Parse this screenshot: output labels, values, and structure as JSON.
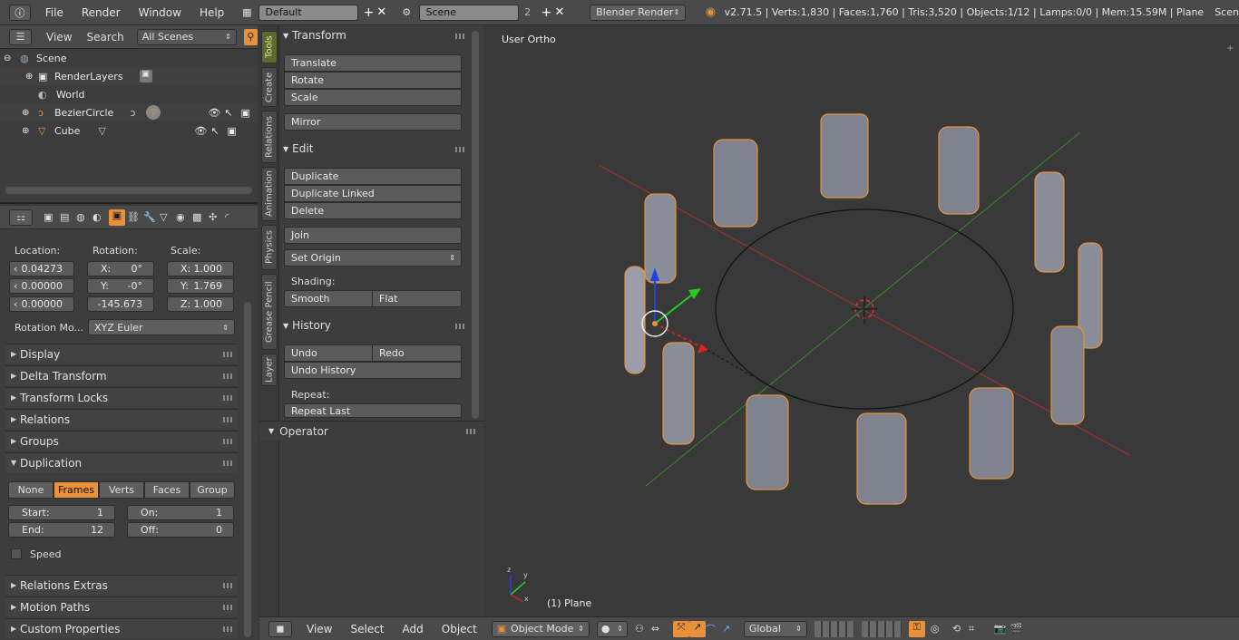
{
  "topbar": {
    "menus": [
      "File",
      "Render",
      "Window",
      "Help"
    ],
    "screen_layout": "Default",
    "scene": "Scene",
    "scene_users": "2",
    "render_engine": "Blender Render",
    "stats": "v2.71.5 | Verts:1,830 | Faces:1,760 | Tris:3,520 | Objects:1/12 | Lamps:0/0 | Mem:15.59M | Plane",
    "right_cut": "Scen"
  },
  "outliner": {
    "header": {
      "view": "View",
      "search": "Search",
      "scene_filter": "All Scenes"
    },
    "items": [
      {
        "label": "Scene"
      },
      {
        "label": "RenderLayers"
      },
      {
        "label": "World"
      },
      {
        "label": "BezierCircle"
      },
      {
        "label": "Cube"
      }
    ]
  },
  "properties": {
    "location_label": "Location:",
    "rotation_label": "Rotation:",
    "scale_label": "Scale:",
    "location": [
      "0.04273",
      "0.00000",
      "0.00000"
    ],
    "rotation": [
      {
        "axis": "X:",
        "val": "0°"
      },
      {
        "axis": "Y:",
        "val": "-0°"
      },
      {
        "axis": "",
        "val": "-145.673"
      }
    ],
    "scale": [
      {
        "axis": "X:",
        "val": "1.000"
      },
      {
        "axis": "Y:",
        "val": "1.769"
      },
      {
        "axis": "Z:",
        "val": "1.000"
      }
    ],
    "rotation_mode_label": "Rotation Mo...",
    "rotation_mode": "XYZ Euler",
    "panels_top": [
      "Display",
      "Delta Transform",
      "Transform Locks",
      "Relations",
      "Groups"
    ],
    "duplication_title": "Duplication",
    "dup_options": [
      "None",
      "Frames",
      "Verts",
      "Faces",
      "Group"
    ],
    "dup_active": "Frames",
    "start": {
      "label": "Start:",
      "val": "1"
    },
    "end": {
      "label": "End:",
      "val": "12"
    },
    "on": {
      "label": "On:",
      "val": "1"
    },
    "off": {
      "label": "Off:",
      "val": "0"
    },
    "speed": "Speed",
    "panels_bottom": [
      "Relations Extras",
      "Motion Paths",
      "Custom Properties"
    ]
  },
  "tool_tabs": [
    "Tools",
    "Create",
    "Relations",
    "Animation",
    "Physics",
    "Grease Pencil",
    "Layer"
  ],
  "tools": {
    "transform": {
      "title": "Transform",
      "items": [
        "Translate",
        "Rotate",
        "Scale"
      ],
      "mirror": "Mirror"
    },
    "edit": {
      "title": "Edit",
      "items": [
        "Duplicate",
        "Duplicate Linked",
        "Delete"
      ],
      "join": "Join",
      "set_origin": "Set Origin",
      "shading_label": "Shading:",
      "smooth": "Smooth",
      "flat": "Flat"
    },
    "history": {
      "title": "History",
      "undo": "Undo",
      "redo": "Redo",
      "undo_history": "Undo History",
      "repeat_label": "Repeat:",
      "repeat_last": "Repeat Last"
    },
    "operator": "Operator"
  },
  "viewport": {
    "view_name": "User Ortho",
    "object_info": "(1) Plane"
  },
  "bottombar": {
    "menus": [
      "View",
      "Select",
      "Add",
      "Object"
    ],
    "mode": "Object Mode",
    "orientation": "Global"
  },
  "colors": {
    "accent": "#e8913a",
    "active_tab": "#5a6a30",
    "bg": "#393939"
  }
}
